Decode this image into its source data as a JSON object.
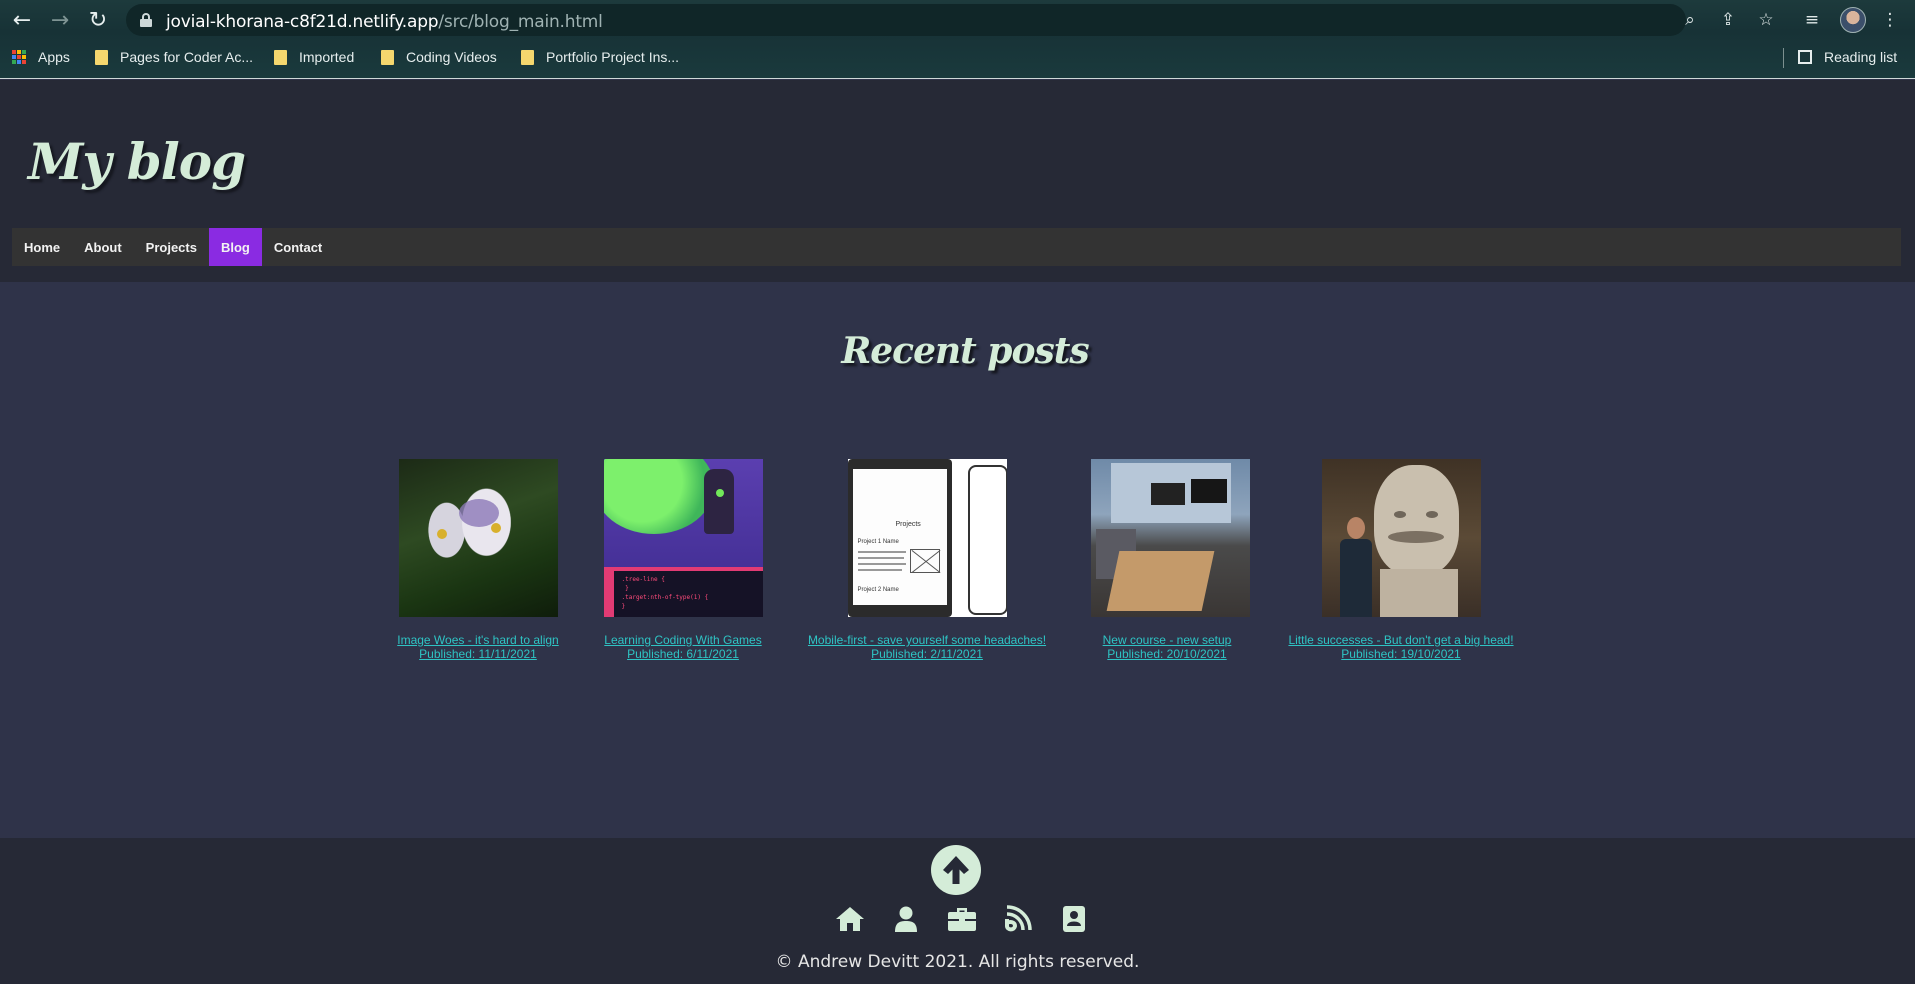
{
  "browser": {
    "url_host": "jovial-khorana-c8f21d.netlify.app",
    "url_path": "/src/blog_main.html",
    "bookmarks": [
      {
        "label": "Apps",
        "icon": "apps-icon"
      },
      {
        "label": "Pages for Coder Ac...",
        "icon": "folder-icon"
      },
      {
        "label": "Imported",
        "icon": "folder-icon"
      },
      {
        "label": "Coding Videos",
        "icon": "folder-icon"
      },
      {
        "label": "Portfolio Project Ins...",
        "icon": "folder-icon"
      }
    ],
    "reading_list": "Reading list"
  },
  "header": {
    "title": "My blog",
    "nav": [
      {
        "label": "Home",
        "active": false
      },
      {
        "label": "About",
        "active": false
      },
      {
        "label": "Projects",
        "active": false
      },
      {
        "label": "Blog",
        "active": true
      },
      {
        "label": "Contact",
        "active": false
      }
    ]
  },
  "main": {
    "title": "Recent posts",
    "posts": [
      {
        "title": "Image Woes - it's hard to align",
        "published": "Published: 11/11/2021",
        "image": "flower-photo"
      },
      {
        "title": "Learning Coding With Games",
        "published": "Published: 6/11/2021",
        "image": "game-screenshot"
      },
      {
        "title": "Mobile-first - save yourself some headaches!",
        "published": "Published: 2/11/2021",
        "image": "wireframe-sketch"
      },
      {
        "title": "New course - new setup",
        "published": "Published: 20/10/2021",
        "image": "desk-setup-photo"
      },
      {
        "title": "Little successes - But don't get a big head!",
        "published": "Published: 19/10/2021",
        "image": "statue-photo"
      }
    ]
  },
  "footer": {
    "icons": [
      "home-icon",
      "user-icon",
      "briefcase-icon",
      "blog-feed-icon",
      "contact-card-icon"
    ],
    "copyright": "© Andrew Devitt 2021. All rights reserved."
  },
  "colors": {
    "accent": "#8a2be2",
    "link": "#2ec4c4",
    "title": "#d4ecd8",
    "main_bg": "#2f3349",
    "header_bg": "#262936"
  }
}
